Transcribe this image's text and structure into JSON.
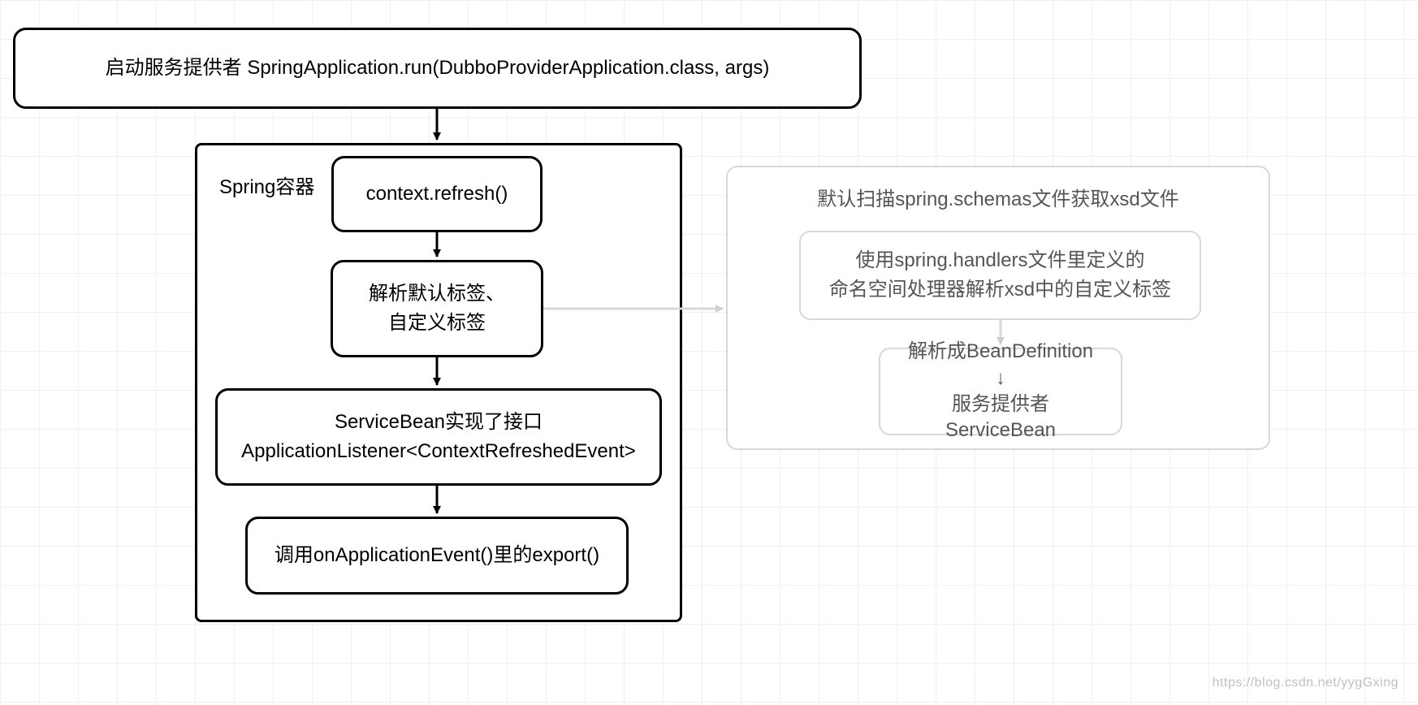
{
  "top_box": "启动服务提供者 SpringApplication.run(DubboProviderApplication.class, args)",
  "spring_container": {
    "label": "Spring容器",
    "step1": "context.refresh()",
    "step2": "解析默认标签、\n自定义标签",
    "step3": "ServiceBean实现了接口\nApplicationListener<ContextRefreshedEvent>",
    "step4": "调用onApplicationEvent()里的export()"
  },
  "right_container": {
    "title": "默认扫描spring.schemas文件获取xsd文件",
    "step1": "使用spring.handlers文件里定义的\n命名空间处理器解析xsd中的自定义标签",
    "step2": "解析成BeanDefinition\n↓\n服务提供者ServiceBean"
  },
  "watermark": "https://blog.csdn.net/yygGxing"
}
